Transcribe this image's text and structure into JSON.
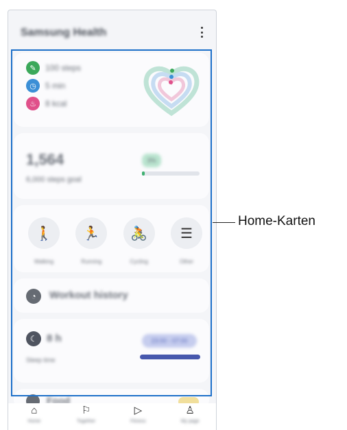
{
  "app": {
    "title": "Samsung Health"
  },
  "cards": {
    "activity": {
      "rows": [
        {
          "icon": "walk-icon",
          "color": "#3ba85a",
          "text": "100 steps"
        },
        {
          "icon": "clock-icon",
          "color": "#3b8fd6",
          "text": "5 min"
        },
        {
          "icon": "flame-icon",
          "color": "#e0508a",
          "text": "8 kcal"
        }
      ]
    },
    "steps": {
      "value": "1,564",
      "subtitle": "6,000 steps goal",
      "badge": "3%"
    },
    "activities": [
      {
        "icon": "walking-icon",
        "glyph": "🚶",
        "label": "Walking"
      },
      {
        "icon": "running-icon",
        "glyph": "🏃",
        "label": "Running"
      },
      {
        "icon": "cycling-icon",
        "glyph": "🚴",
        "label": "Cycling"
      },
      {
        "icon": "list-icon",
        "glyph": "☰",
        "label": "Other"
      }
    ],
    "workout": {
      "title": "Workout history"
    },
    "sleep": {
      "value": "8 h",
      "subtitle": "Sleep time",
      "range": "23:00 - 07:00"
    },
    "food": {
      "title": "Food"
    }
  },
  "nav": [
    {
      "icon": "home-icon",
      "glyph": "⌂",
      "label": "Home"
    },
    {
      "icon": "flag-icon",
      "glyph": "⚐",
      "label": "Together"
    },
    {
      "icon": "fitness-play-icon",
      "glyph": "▷",
      "label": "Fitness"
    },
    {
      "icon": "person-icon",
      "glyph": "♙",
      "label": "My page"
    }
  ],
  "callout": {
    "label": "Home-Karten"
  }
}
